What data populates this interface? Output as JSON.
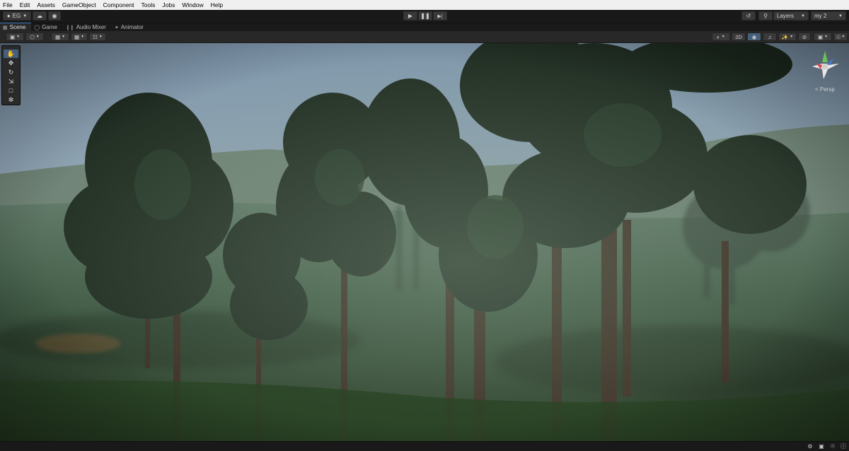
{
  "menu": [
    "File",
    "Edit",
    "Assets",
    "GameObject",
    "Component",
    "Tools",
    "Jobs",
    "Window",
    "Help"
  ],
  "toolbar": {
    "account_label": "EG",
    "layers_label": "Layers",
    "layout_label": "my 2"
  },
  "tabs": [
    {
      "label": "Scene",
      "icon": "grid-icon"
    },
    {
      "label": "Game",
      "icon": "gamepad-icon"
    },
    {
      "label": "Audio Mixer",
      "icon": "mixer-icon"
    },
    {
      "label": "Animator",
      "icon": "animator-icon"
    }
  ],
  "scene_toolbar": {
    "mode_2d_label": "2D"
  },
  "viewport": {
    "projection_label": "< Persp"
  },
  "colors": {
    "accent": "#3a79bb",
    "active_tool": "#46607c",
    "panel": "#282828",
    "background": "#191919"
  }
}
